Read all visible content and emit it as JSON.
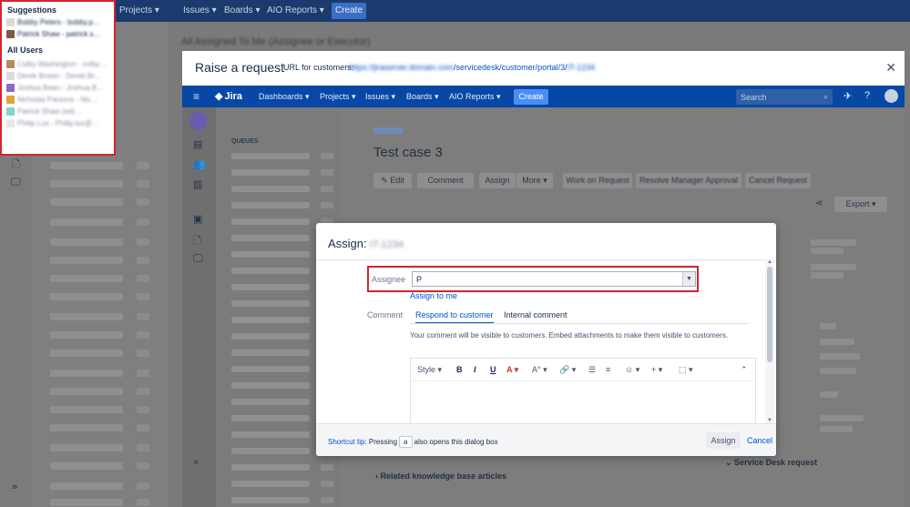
{
  "background": {
    "nav": [
      "Projects ▾",
      "Issues ▾",
      "Boards ▾",
      "AIO Reports ▾"
    ],
    "create_label": "Create",
    "title": "All Assigned To Me (Assignee or Executor)"
  },
  "suggestions": {
    "header": "Suggestions",
    "items": [
      "Bobby Peters - bobby.p…",
      "Patrick Shaw - patrick.s…"
    ],
    "all_users_header": "All Users",
    "users": [
      "Colby Washington - colby…",
      "Derek Brown - Derek.Br…",
      "Joshua Bean - Joshua.B…",
      "Nicholas Parsons - Nic…",
      "Patrick Shaw (ed)…",
      "Philip Lux - Philip.lux@…"
    ]
  },
  "modal": {
    "title": "Raise a request",
    "url_label": "URL for customers:",
    "url_host": "https://jiraserver.domain.com",
    "url_path": "/servicedesk/customer/portal/3/",
    "url_suffix": "IT-1234",
    "close": "✕"
  },
  "inner_nav": {
    "menu_icon": "≡",
    "logo": "Jira",
    "items": [
      "Dashboards ▾",
      "Projects ▾",
      "Issues ▾",
      "Boards ▾",
      "AIO Reports ▾"
    ],
    "create": "Create",
    "search_placeholder": "Search"
  },
  "issue": {
    "queues_header": "QUEUES",
    "title": "Test case 3",
    "buttons": [
      "✎ Edit",
      "Comment",
      "Assign",
      "More ▾",
      "Work on Request",
      "Resolve Manager Approval",
      "Cancel Request"
    ],
    "export_label": "Export ▾",
    "related_label": "Related knowledge base articles",
    "sdr_label": "Service Desk request"
  },
  "assign": {
    "title": "Assign:",
    "title_key": "IT-1234",
    "assignee_label": "Assignee",
    "assignee_value": "P",
    "assign_to_me": "Assign to me",
    "comment_label": "Comment",
    "tab_respond": "Respond to customer",
    "tab_internal": "Internal comment",
    "comment_help": "Your comment will be visible to customers. Embed attachments to make them visible to customers.",
    "toolbar": {
      "style": "Style ▾",
      "bold": "B",
      "italic": "I",
      "underline": "U",
      "color": "A ▾",
      "more_text": "A° ▾",
      "link": "🔗 ▾",
      "bullets": "☰",
      "numbers": "≡",
      "emoji": "☺ ▾",
      "insert": "+ ▾",
      "macro": "⬚ ▾",
      "collapse": "⌃"
    },
    "shortcut_lead": "Shortcut tip:",
    "shortcut_pre": "Pressing",
    "shortcut_key": "a",
    "shortcut_post": "also opens this dialog box",
    "assign_button": "Assign",
    "cancel_button": "Cancel"
  },
  "colors": {
    "brand": "#0747a6",
    "link": "#0052cc",
    "highlight_border": "#d0262e"
  }
}
